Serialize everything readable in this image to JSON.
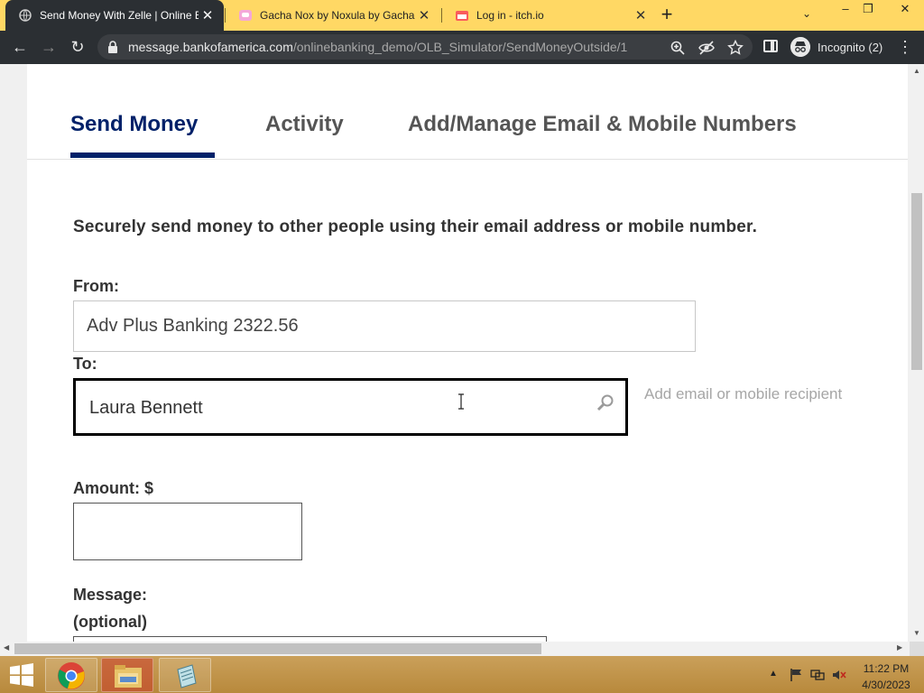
{
  "browser": {
    "tabs": [
      {
        "title": "Send Money With Zelle | Online B",
        "active": true
      },
      {
        "title": "Gacha Nox by Noxula by Gacha N",
        "active": false
      },
      {
        "title": "Log in - itch.io",
        "active": false
      }
    ],
    "tab_close_glyph": "✕",
    "new_tab_glyph": "+",
    "tab_search_glyph": "⌄",
    "window_controls": {
      "minimize": "–",
      "restore": "❐",
      "close": "✕"
    },
    "nav": {
      "back": "←",
      "forward": "→",
      "reload": "↻"
    },
    "url": {
      "host": "message.bankofamerica.com",
      "path": "/onlinebanking_demo/OLB_Simulator/SendMoneyOutside/1"
    },
    "incognito_label": "Incognito (2)",
    "menu_glyph": "⋮",
    "icons": [
      "lock-icon",
      "zoom-icon",
      "eye-off-icon",
      "star-icon",
      "side-panel-icon",
      "incognito-icon"
    ]
  },
  "page": {
    "tabs": [
      {
        "label": "Send Money",
        "active": true
      },
      {
        "label": "Activity",
        "active": false
      },
      {
        "label": "Add/Manage Email & Mobile Numbers",
        "active": false
      }
    ],
    "intro": "Securely send money to other people using their email address or mobile number.",
    "from": {
      "label": "From:",
      "value": "Adv Plus Banking 2322.56"
    },
    "to": {
      "label": "To:",
      "value": "Laura Bennett"
    },
    "add_recipient_link": "Add email or mobile recipient",
    "amount": {
      "label": "Amount: $",
      "value": ""
    },
    "message": {
      "label": "Message:",
      "optional": "(optional)",
      "value": ""
    }
  },
  "scrollbars": {
    "up": "▲",
    "down": "▼",
    "left": "◀",
    "right": "▶"
  },
  "taskbar": {
    "apps": [
      "chrome",
      "file-explorer",
      "notes"
    ],
    "tray_arrow": "▲",
    "clock": {
      "time": "11:22 PM",
      "date": "4/30/2023"
    }
  },
  "colors": {
    "tabstrip": "#ffd864",
    "chrome_dark": "#2b2f33",
    "brand_navy": "#012169"
  }
}
